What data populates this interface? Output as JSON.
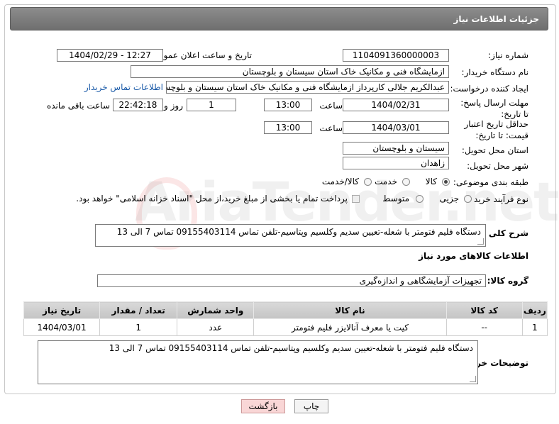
{
  "header": {
    "title": "جزئیات اطلاعات نیاز"
  },
  "fields": {
    "need_number_label": "شماره نیاز:",
    "need_number": "1104091360000003",
    "announce_label": "تاریخ و ساعت اعلان عمومی:",
    "announce_value": "1404/02/29 - 12:27",
    "buyer_org_label": "نام دستگاه خریدار:",
    "buyer_org": "ازمایشگاه فنی و مکانیک خاک استان سیستان و بلوچستان",
    "creator_label": "ایجاد کننده درخواست:",
    "creator": "عبدالکریم جلالی کارپرداز ازمایشگاه فنی و مکانیک خاک استان سیستان و بلوچستان",
    "contact_link": "اطلاعات تماس خریدار",
    "reply_deadline_label": "مهلت ارسال پاسخ: تا تاریخ:",
    "reply_date": "1404/02/31",
    "time_label": "ساعت",
    "reply_time": "13:00",
    "days_value": "1",
    "days_label": "روز و",
    "remaining_time": "22:42:18",
    "remaining_label": "ساعت باقی مانده",
    "price_deadline_label": "حداقل تاریخ اعتبار قیمت: تا تاریخ:",
    "price_date": "1404/03/01",
    "price_time": "13:00",
    "province_label": "استان محل تحویل:",
    "province": "سیستان و بلوچستان",
    "city_label": "شهر محل تحویل:",
    "city": "زاهدان",
    "category_label": "طبقه بندی موضوعی:",
    "category_options": [
      "کالا",
      "خدمت",
      "کالا/خدمت"
    ],
    "process_label": "نوع فرآیند خرید :",
    "process_options": [
      "جزیی",
      "متوسط"
    ],
    "payment_note": "پرداخت تمام یا بخشی از مبلغ خرید،از محل \"اسناد خزانه اسلامی\" خواهد بود."
  },
  "description": {
    "label": "شرح کلی نیاز:",
    "text": "دستگاه فلیم فتومتر با شعله-تعیین سدیم وکلسیم وپتاسیم-تلفن تماس 09155403114 تماس 7 الی 13"
  },
  "goods": {
    "section_title": "اطلاعات کالاهای مورد نیاز",
    "group_label": "گروه کالا:",
    "group_value": "تجهیزات آزمایشگاهی و اندازه‌گیری",
    "table_headers": [
      "ردیف",
      "کد کالا",
      "نام کالا",
      "واحد شمارش",
      "تعداد / مقدار",
      "تاریخ نیاز"
    ],
    "table_rows": [
      [
        "1",
        "--",
        "کیت یا معرف آنالایزر فلیم فتومتر",
        "عدد",
        "1",
        "1404/03/01"
      ]
    ]
  },
  "buyer_notes": {
    "label": "توضیحات خریدار:",
    "text": "دستگاه فلیم فتومتر با شعله-تعیین سدیم وکلسیم وپتاسیم-تلفن تماس 09155403114 تماس 7 الی 13"
  },
  "buttons": {
    "print": "چاپ",
    "back": "بازگشت"
  },
  "watermark": "AriaTender.net",
  "colors": {
    "header_bg": "#7d7d7d",
    "back_button_bg": "#f9d6d6",
    "link": "#1a5aa8"
  }
}
